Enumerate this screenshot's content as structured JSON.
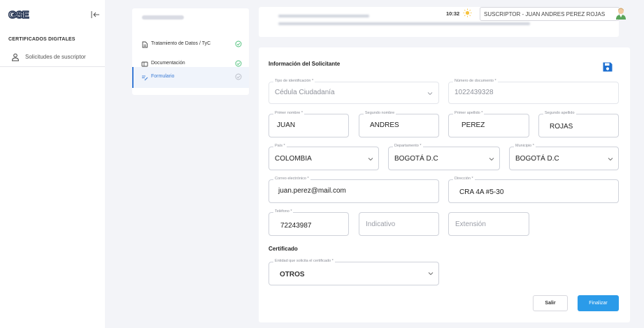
{
  "sidebar": {
    "section_title": "CERTIFICADOS DIGITALES",
    "items": [
      {
        "label": "Solicitudes de suscriptor"
      }
    ]
  },
  "steps": [
    {
      "label": "Tratamiento de Datos / TyC",
      "done": true
    },
    {
      "label": "Documentación",
      "done": true
    },
    {
      "label": "Formulario",
      "done": false
    }
  ],
  "header": {
    "time": "10:32",
    "user": "SUSCRIPTOR  -  JUAN ANDRES PEREZ ROJAS"
  },
  "form": {
    "title": "Información del Solicitante",
    "tipo_id": {
      "label": "Tipo de identificación *",
      "value": "Cédula Ciudadanía"
    },
    "num_doc": {
      "label": "Número de documento *",
      "value": "1022439328"
    },
    "primer_nombre": {
      "label": "Primer nombre *",
      "value": "JUAN"
    },
    "segundo_nombre": {
      "label": "Segundo nombre",
      "value": "ANDRES"
    },
    "primer_apellido": {
      "label": "Primer apellido *",
      "value": "PEREZ"
    },
    "segundo_apellido": {
      "label": "Segundo apellido",
      "value": "ROJAS"
    },
    "pais": {
      "label": "País *",
      "value": "COLOMBIA"
    },
    "departamento": {
      "label": "Departamento *",
      "value": "BOGOTÁ D.C"
    },
    "municipio": {
      "label": "Municipio *",
      "value": "BOGOTÁ D.C"
    },
    "correo": {
      "label": "Correo electrónico *",
      "value": "juan.perez@mail.com"
    },
    "direccion": {
      "label": "Dirección *",
      "value": "CRA 4A #5-30"
    },
    "telefono": {
      "label": "Teléfono *",
      "value": "72243987"
    },
    "indicativo": {
      "placeholder": "Indicativo"
    },
    "extension": {
      "placeholder": "Extensión"
    },
    "cert_section": "Certificado",
    "entidad": {
      "label": "Entidad que solicita el certificado *",
      "value": "OTROS"
    }
  },
  "buttons": {
    "salir": "Salir",
    "finalizar": "Finalizar"
  },
  "colors": {
    "accent": "#2b9be9",
    "success": "#4cc07a",
    "save_icon": "#1d6fd0"
  }
}
